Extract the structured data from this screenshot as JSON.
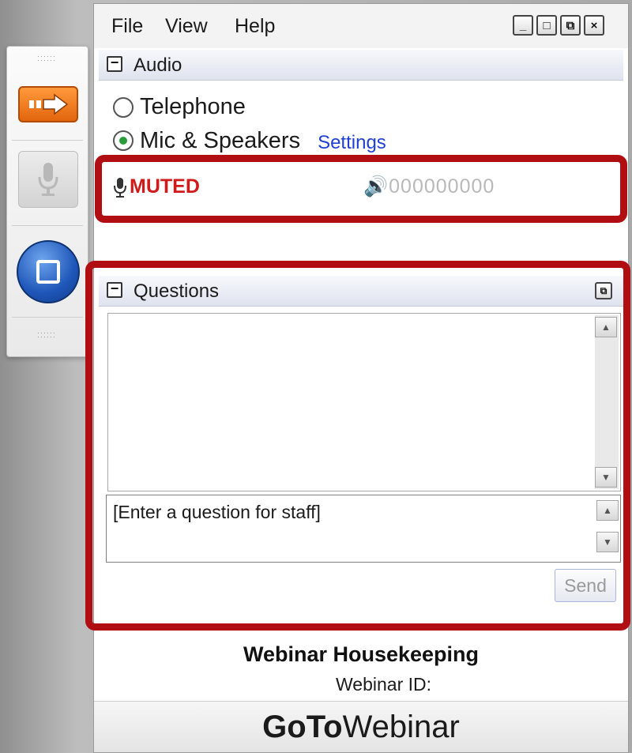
{
  "menu": {
    "file": "File",
    "view": "View",
    "help": "Help"
  },
  "window_controls": {
    "minimize": "_",
    "maximize": "□",
    "restore": "⧉",
    "close": "×"
  },
  "audio": {
    "title": "Audio",
    "options": {
      "telephone": "Telephone",
      "mic_speakers": "Mic & Speakers"
    },
    "selected": "Mic & Speakers",
    "settings_link": "Settings",
    "status": "MUTED",
    "level_meter": "000000000"
  },
  "questions": {
    "title": "Questions",
    "input_placeholder": "[Enter a question for staff]",
    "send_label": "Send"
  },
  "footer": {
    "title": "Webinar Housekeeping",
    "webinar_id_label": "Webinar ID:",
    "brand_bold": "GoTo",
    "brand_rest": "Webinar"
  },
  "colors": {
    "highlight_red": "#b00e12",
    "muted_red": "#d11a1a",
    "link_blue": "#1f3fd6",
    "orange_button": "#f07a16",
    "screen_button_blue": "#1e56b8"
  }
}
